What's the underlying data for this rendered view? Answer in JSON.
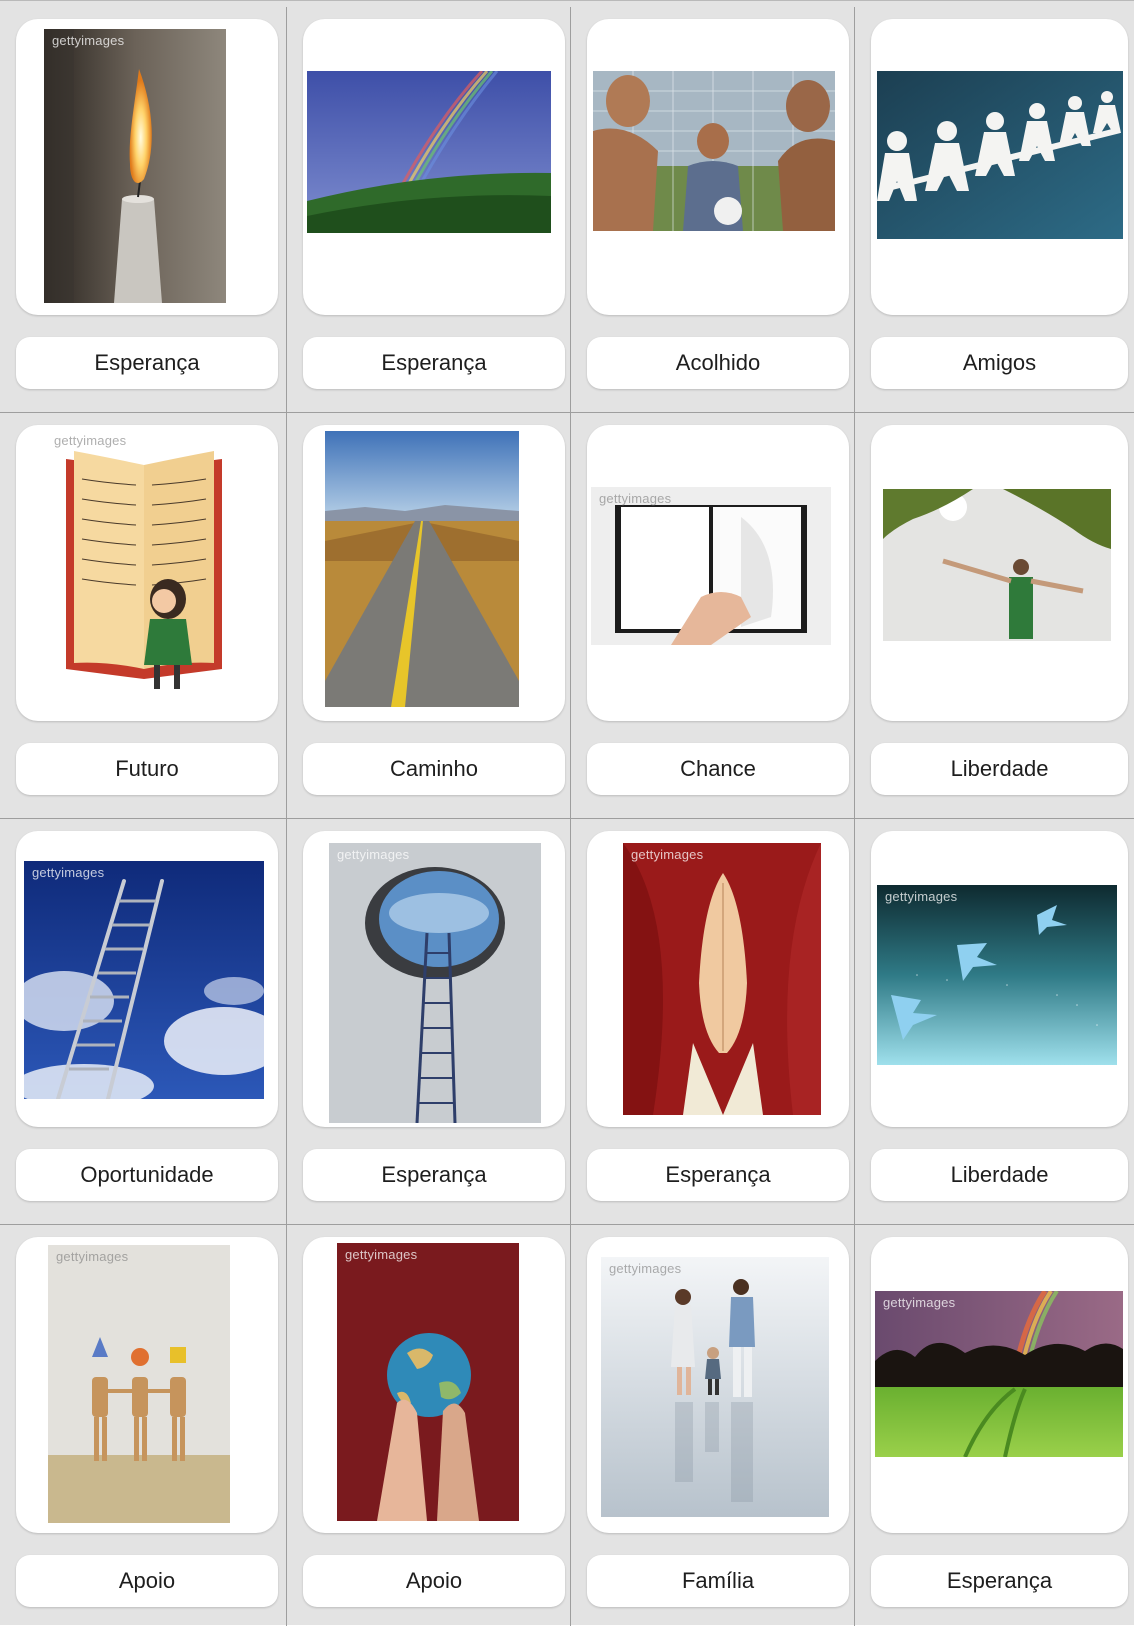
{
  "watermark": "gettyimages",
  "cards": [
    {
      "label": "Esperança",
      "image": "candle-flame"
    },
    {
      "label": "Esperança",
      "image": "rainbow-over-hills"
    },
    {
      "label": "Acolhido",
      "image": "boys-at-soccer-goal"
    },
    {
      "label": "Amigos",
      "image": "paper-doll-chain"
    },
    {
      "label": "Futuro",
      "image": "girl-with-giant-book"
    },
    {
      "label": "Caminho",
      "image": "open-road"
    },
    {
      "label": "Chance",
      "image": "hand-turning-blank-page"
    },
    {
      "label": "Liberdade",
      "image": "man-arms-open-under-trees"
    },
    {
      "label": "Oportunidade",
      "image": "ladder-to-sky"
    },
    {
      "label": "Esperança",
      "image": "ladder-through-hole"
    },
    {
      "label": "Esperança",
      "image": "praying-hands"
    },
    {
      "label": "Liberdade",
      "image": "flying-angels"
    },
    {
      "label": "Apoio",
      "image": "wooden-mannequins-holding-hands"
    },
    {
      "label": "Apoio",
      "image": "hands-holding-globe"
    },
    {
      "label": "Família",
      "image": "family-holding-hands"
    },
    {
      "label": "Esperança",
      "image": "rainbow-over-field"
    }
  ]
}
